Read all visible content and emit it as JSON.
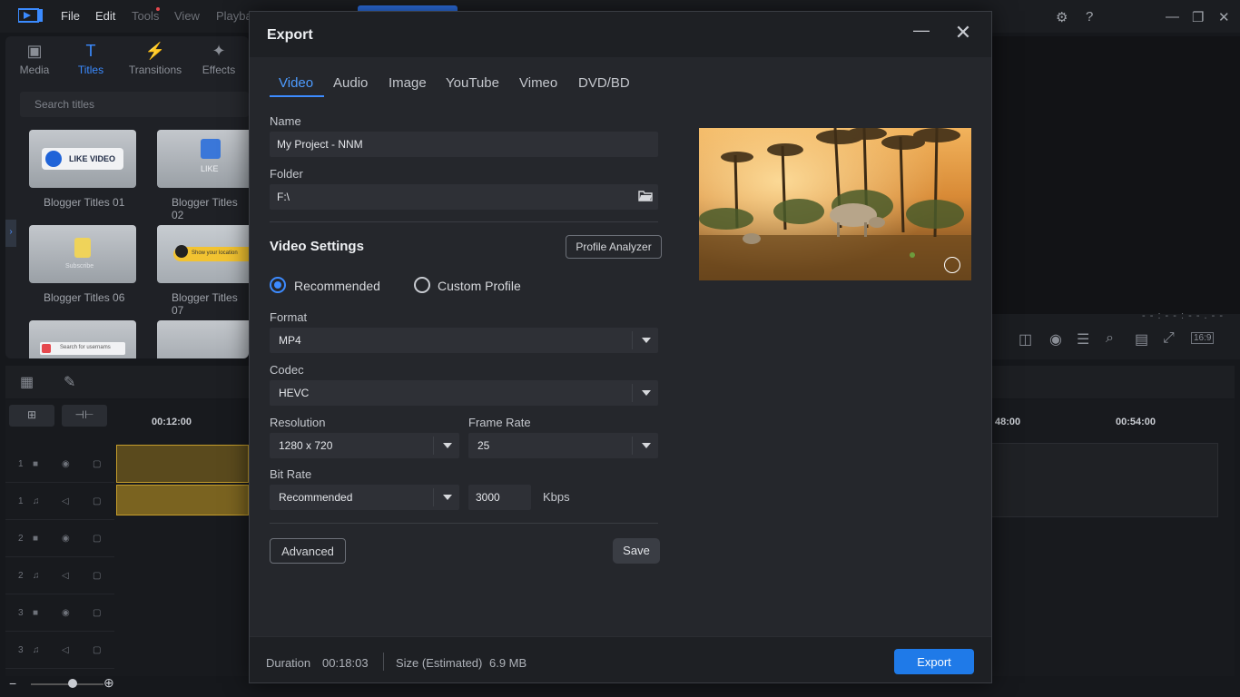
{
  "app": {
    "menu": [
      "File",
      "Edit",
      "Tools",
      "View",
      "Playba"
    ],
    "left_tabs": [
      {
        "label": "Media",
        "icon": "media-icon"
      },
      {
        "label": "Titles",
        "icon": "titles-icon"
      },
      {
        "label": "Transitions",
        "icon": "transitions-icon"
      },
      {
        "label": "Effects",
        "icon": "effects-icon"
      }
    ],
    "search_placeholder": "Search titles",
    "thumbnails": [
      {
        "caption": "Blogger Titles 01",
        "badge": "LIKE VIDEO"
      },
      {
        "caption": "Blogger Titles 02",
        "badge": "LIKE"
      },
      {
        "caption": "Blogger Titles 06",
        "badge": "Subscribe"
      },
      {
        "caption": "Blogger Titles 07",
        "badge": "Show your location"
      },
      {
        "caption": "",
        "badge": "Search for usernams"
      },
      {
        "caption": "",
        "badge": ""
      }
    ],
    "timeline": {
      "ruler": [
        "00:12:00",
        "48:00",
        "00:54:00"
      ],
      "tracks": [
        "1",
        "1",
        "2",
        "2",
        "3",
        "3"
      ]
    },
    "preview_timecode": "- - : - - : - - . - -",
    "aspect_ratio": "16:9",
    "accent_color": "#3d8bff"
  },
  "dialog": {
    "title": "Export",
    "tabs": [
      "Video",
      "Audio",
      "Image",
      "YouTube",
      "Vimeo",
      "DVD/BD"
    ],
    "active_tab": "Video",
    "name_label": "Name",
    "name_value": "My Project - NNM",
    "folder_label": "Folder",
    "folder_value": "F:\\",
    "video_settings_title": "Video Settings",
    "profile_analyzer_label": "Profile Analyzer",
    "radio_recommended": "Recommended",
    "radio_custom": "Custom Profile",
    "selected_profile": "Recommended",
    "format_label": "Format",
    "format_value": "MP4",
    "codec_label": "Codec",
    "codec_value": "HEVC",
    "resolution_label": "Resolution",
    "resolution_value": "1280 x 720",
    "framerate_label": "Frame Rate",
    "framerate_value": "25",
    "bitrate_label": "Bit Rate",
    "bitrate_value": "Recommended",
    "bitrate_number": "3000",
    "bitrate_unit": "Kbps",
    "advanced_label": "Advanced",
    "save_label": "Save",
    "duration_label": "Duration",
    "duration_value": "00:18:03",
    "size_label": "Size (Estimated)",
    "size_value": "6.9 MB",
    "export_label": "Export",
    "export_color": "#1f7ae8"
  }
}
